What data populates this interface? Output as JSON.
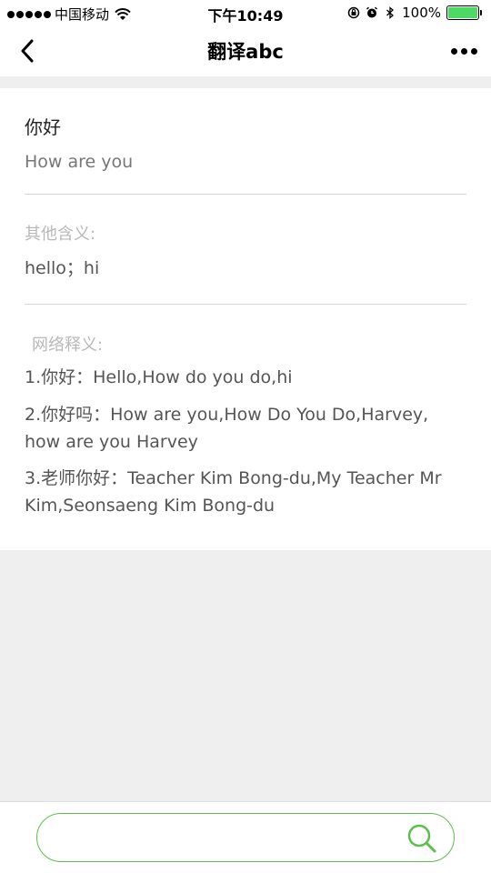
{
  "status_bar": {
    "carrier": "中国移动",
    "time": "下午10:49",
    "battery": "100%",
    "battery_level": 1.0,
    "battery_color": "#4cd964"
  },
  "nav": {
    "title": "翻译abc"
  },
  "result": {
    "source": "你好",
    "translation": "How are you",
    "other_label": "其他含义:",
    "other_meanings": "hello；hi",
    "web_label": "网络释义:",
    "web_definitions": [
      "1.你好：Hello,How do you do,hi",
      "2.你好吗：How are you,How Do You Do,Harvey, how are you Harvey",
      "3.老师你好：Teacher Kim Bong-du,My Teacher Mr Kim,Seonsaeng Kim Bong-du"
    ]
  },
  "search": {
    "value": "",
    "accent_color": "#5cbf4c"
  }
}
